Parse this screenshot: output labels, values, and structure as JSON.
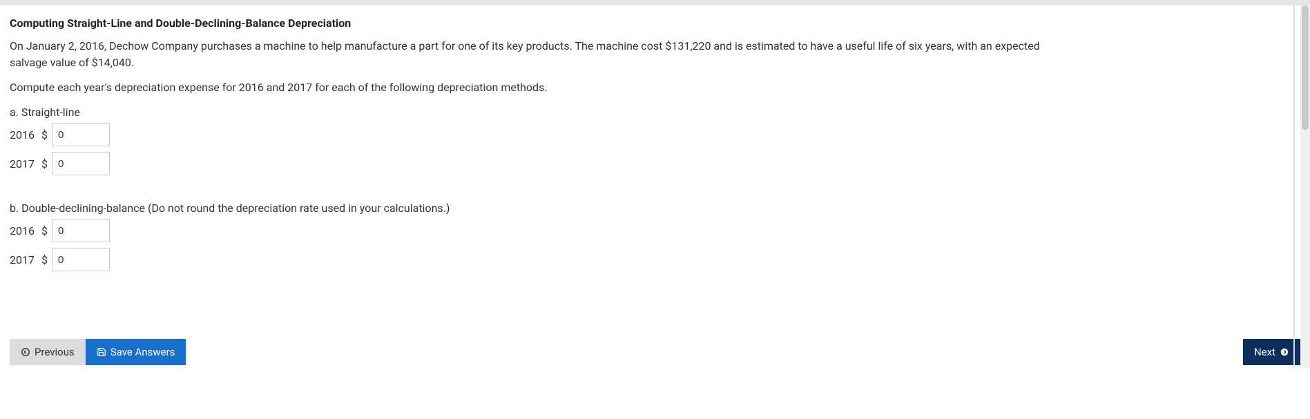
{
  "problem": {
    "title": "Computing Straight-Line and Double-Declining-Balance Depreciation",
    "description": "On January 2, 2016, Dechow Company purchases a machine to help manufacture a part for one of its key products. The machine cost $131,220 and is estimated to have a useful life of six years, with an expected salvage value of $14,040.",
    "instruction": "Compute each year's depreciation expense for 2016 and 2017 for each of the following depreciation methods.",
    "section_a": {
      "label": "a. Straight-line",
      "rows": [
        {
          "year": "2016",
          "currency": "$",
          "value": "0"
        },
        {
          "year": "2017",
          "currency": "$",
          "value": "0"
        }
      ]
    },
    "section_b": {
      "label": "b. Double-declining-balance (Do not round the depreciation rate used in your calculations.)",
      "rows": [
        {
          "year": "2016",
          "currency": "$",
          "value": "0"
        },
        {
          "year": "2017",
          "currency": "$",
          "value": "0"
        }
      ]
    }
  },
  "nav": {
    "previous": "Previous",
    "save": "Save Answers",
    "next": "Next"
  }
}
